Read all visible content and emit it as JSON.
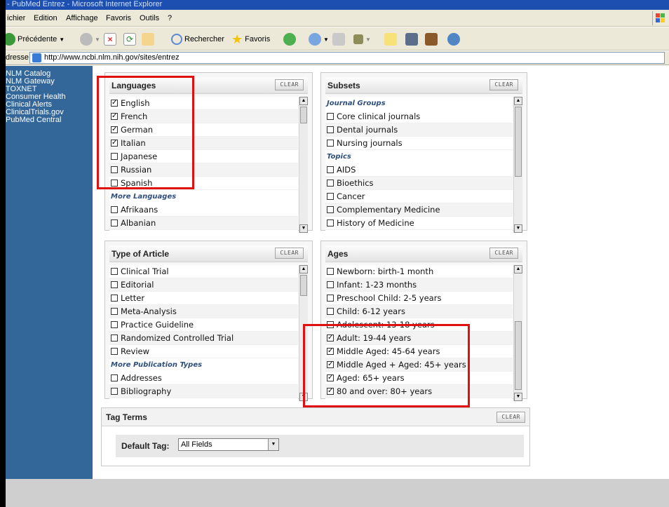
{
  "window": {
    "title": "- PubMed Entrez - Microsoft Internet Explorer"
  },
  "menu": [
    "ichier",
    "Edition",
    "Affichage",
    "Favoris",
    "Outils",
    "?"
  ],
  "toolbar": {
    "back_label": "Précédente",
    "search_label": "Rechercher",
    "favorites_label": "Favoris"
  },
  "address": {
    "label": "dresse",
    "url": "http://www.ncbi.nlm.nih.gov/sites/entrez"
  },
  "sidebar": {
    "links": [
      "NLM Catalog",
      "NLM Gateway",
      "TOXNET",
      "Consumer Health",
      "Clinical Alerts",
      "ClinicalTrials.gov",
      "PubMed Central"
    ]
  },
  "clear_label": "CLEAR",
  "languages": {
    "title": "Languages",
    "items": [
      {
        "type": "item",
        "label": "English",
        "checked": true
      },
      {
        "type": "item",
        "label": "French",
        "checked": true
      },
      {
        "type": "item",
        "label": "German",
        "checked": true
      },
      {
        "type": "item",
        "label": "Italian",
        "checked": true
      },
      {
        "type": "item",
        "label": "Japanese",
        "checked": false
      },
      {
        "type": "item",
        "label": "Russian",
        "checked": false
      },
      {
        "type": "item",
        "label": "Spanish",
        "checked": false
      },
      {
        "type": "group",
        "label": "More Languages"
      },
      {
        "type": "item",
        "label": "Afrikaans",
        "checked": false
      },
      {
        "type": "item",
        "label": "Albanian",
        "checked": false
      }
    ]
  },
  "subsets": {
    "title": "Subsets",
    "items": [
      {
        "type": "group",
        "label": "Journal Groups"
      },
      {
        "type": "item",
        "label": "Core clinical journals",
        "checked": false
      },
      {
        "type": "item",
        "label": "Dental journals",
        "checked": false
      },
      {
        "type": "item",
        "label": "Nursing journals",
        "checked": false
      },
      {
        "type": "group",
        "label": "Topics"
      },
      {
        "type": "item",
        "label": "AIDS",
        "checked": false
      },
      {
        "type": "item",
        "label": "Bioethics",
        "checked": false
      },
      {
        "type": "item",
        "label": "Cancer",
        "checked": false
      },
      {
        "type": "item",
        "label": "Complementary Medicine",
        "checked": false
      },
      {
        "type": "item",
        "label": "History of Medicine",
        "checked": false
      }
    ]
  },
  "article_types": {
    "title": "Type of Article",
    "items": [
      {
        "type": "item",
        "label": "Clinical Trial",
        "checked": false
      },
      {
        "type": "item",
        "label": "Editorial",
        "checked": false
      },
      {
        "type": "item",
        "label": "Letter",
        "checked": false
      },
      {
        "type": "item",
        "label": "Meta-Analysis",
        "checked": false
      },
      {
        "type": "item",
        "label": "Practice Guideline",
        "checked": false
      },
      {
        "type": "item",
        "label": "Randomized Controlled Trial",
        "checked": false
      },
      {
        "type": "item",
        "label": "Review",
        "checked": false
      },
      {
        "type": "group",
        "label": "More Publication Types"
      },
      {
        "type": "item",
        "label": "Addresses",
        "checked": false
      },
      {
        "type": "item",
        "label": "Bibliography",
        "checked": false
      }
    ]
  },
  "ages": {
    "title": "Ages",
    "items": [
      {
        "type": "item",
        "label": "Newborn: birth-1 month",
        "checked": false
      },
      {
        "type": "item",
        "label": "Infant: 1-23 months",
        "checked": false
      },
      {
        "type": "item",
        "label": "Preschool Child: 2-5 years",
        "checked": false
      },
      {
        "type": "item",
        "label": "Child: 6-12 years",
        "checked": false
      },
      {
        "type": "item",
        "label": "Adolescent: 13-18 years",
        "checked": false
      },
      {
        "type": "item",
        "label": "Adult: 19-44 years",
        "checked": true
      },
      {
        "type": "item",
        "label": "Middle Aged: 45-64 years",
        "checked": true
      },
      {
        "type": "item",
        "label": "Middle Aged + Aged: 45+ years",
        "checked": true
      },
      {
        "type": "item",
        "label": "Aged: 65+ years",
        "checked": true
      },
      {
        "type": "item",
        "label": "80 and over: 80+ years",
        "checked": true
      }
    ]
  },
  "tag_terms": {
    "title": "Tag Terms",
    "default_tag_label": "Default Tag:",
    "default_tag_value": "All Fields"
  },
  "colors": {
    "sidebar": "#336699",
    "highlight": "#e01010",
    "group_text": "#2e4f7d"
  }
}
